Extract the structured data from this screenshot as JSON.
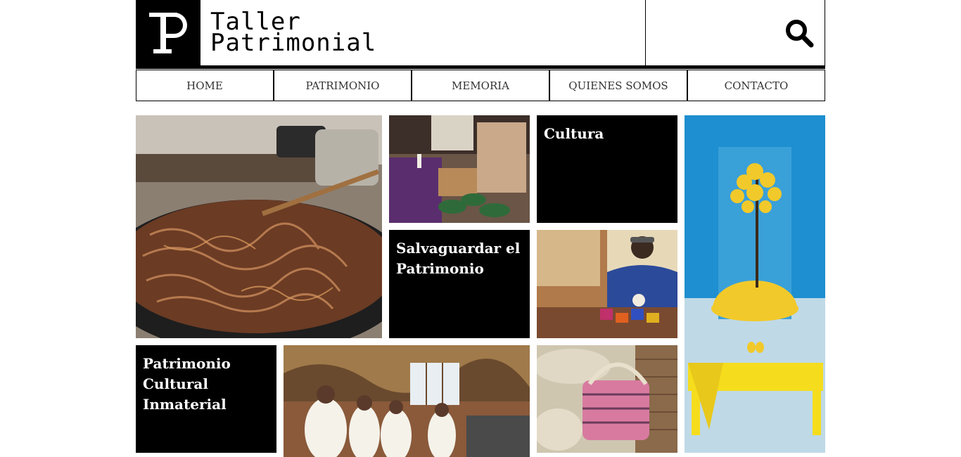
{
  "header": {
    "logo_letter": "P",
    "brand_line1": "Taller",
    "brand_line2": "Patrimonial",
    "search_icon": "search-icon"
  },
  "nav": {
    "items": [
      {
        "label": "HOME"
      },
      {
        "label": "PATRIMONIO"
      },
      {
        "label": "MEMORIA"
      },
      {
        "label": "QUIENES SOMOS"
      },
      {
        "label": "CONTACTO"
      }
    ]
  },
  "tiles": {
    "cultura": "Cultura",
    "salvaguardar": "Salvaguardar el Patrimonio",
    "inmaterial": "Patrimonio Cultural Inmaterial"
  },
  "colors": {
    "tile_bg": "#000000",
    "tile_text": "#ffffff",
    "border": "#000000",
    "nav_text": "#333333"
  }
}
